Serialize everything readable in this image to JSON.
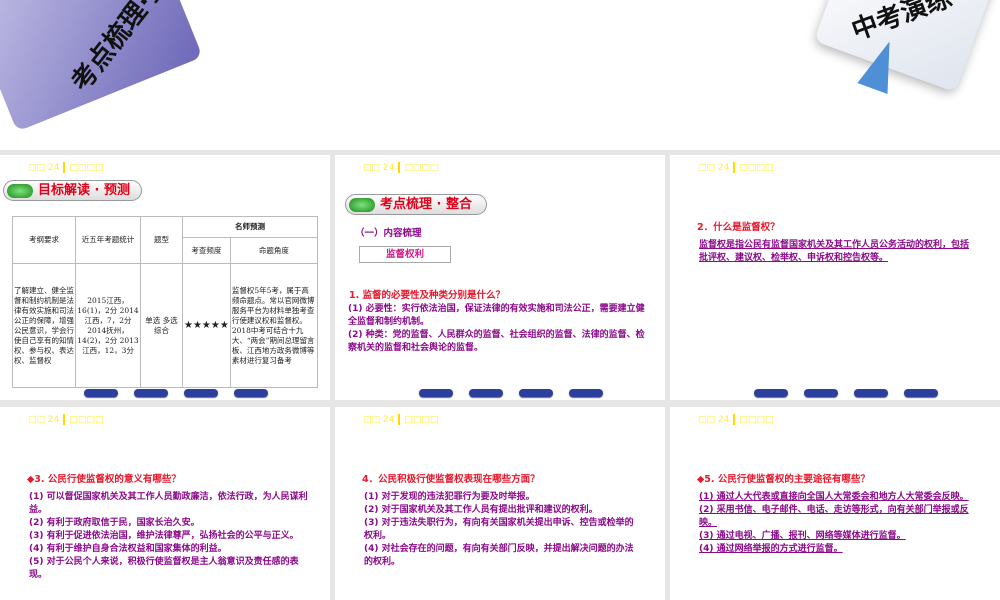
{
  "decorations": {
    "left_label": "考点梳理·整合",
    "right_label": "中考演练"
  },
  "header": {
    "lecture": "□□ 24",
    "title": "□□□□"
  },
  "slide1": {
    "pill": "目标解读 · 预测",
    "table": {
      "h_req": "考纲要求",
      "h_stat": "近五年考题统计",
      "h_type": "题型",
      "h_pred": "名师预测",
      "h_freq": "考查频度",
      "h_angle": "命题角度",
      "req": "了解建立、健全监督和制约机制是法律有效实施和司法公正的保障，增强公民意识，学会行使自己享有的知情权、参与权、表达权、监督权",
      "stat": "2015江西，16(1)，2分 2014江西，7，2分 2014抚州，14(2)，2分 2013江西，12，3分",
      "type": "单选 多选 综合",
      "freq": "★★★★★",
      "angle": "监督权5年5考，属于高频命题点。常以官网微博服务平台为材料单独考查行使建议权和监督权。2018中考可结合十九大、“两会”期间总理留言板、江西地方政务微博等素材进行复习备考"
    }
  },
  "slide2": {
    "pill": "考点梳理 · 整合",
    "sub": "（一）内容梳理",
    "box": "监督权利",
    "q": "1. 监督的必要性及种类分别是什么？",
    "a": [
      "(1) 必要性：实行依法治国，保证法律的有效实施和司法公正，需要建立健全监督和制约机制。",
      "(2) 种类：党的监督、人民群众的监督、社会组织的监督、法律的监督、检察机关的监督和社会舆论的监督。"
    ]
  },
  "slide3": {
    "q": "2．什么是监督权？",
    "a": "监督权是指公民有监督国家机关及其工作人员公务活动的权利，包括批评权、建议权、检举权、申诉权和控告权等。"
  },
  "slide4": {
    "q": "◆3. 公民行使监督权的意义有哪些？",
    "a": [
      "(1) 可以督促国家机关及其工作人员勤政廉洁，依法行政，为人民谋利益。",
      "(2) 有利于政府取信于民，国家长治久安。",
      "(3) 有利于促进依法治国，维护法律尊严，弘扬社会的公平与正义。",
      "(4) 有利于维护自身合法权益和国家集体的利益。",
      "(5) 对于公民个人来说，积极行使监督权是主人翁意识及责任感的表现。"
    ]
  },
  "slide5": {
    "q": "4．公民积极行使监督权表现在哪些方面？",
    "a": [
      "(1) 对于发现的违法犯罪行为要及时举报。",
      "(2) 对于国家机关及其工作人员有提出批评和建议的权利。",
      "(3) 对于违法失职行为，有向有关国家机关提出申诉、控告或检举的权利。",
      "(4) 对社会存在的问题，有向有关部门反映，并提出解决问题的办法的权利。"
    ]
  },
  "slide6": {
    "q": "◆5. 公民行使监督权的主要途径有哪些？",
    "a": [
      "(1) 通过人大代表或直接向全国人大常委会和地方人大常委会反映。",
      "(2) 采用书信、电子邮件、电话、走访等形式，向有关部门举报或反映。",
      "(3) 通过电视、广播、报刊、网络等媒体进行监督。",
      "(4) 通过网络举报的方式进行监督。"
    ]
  }
}
